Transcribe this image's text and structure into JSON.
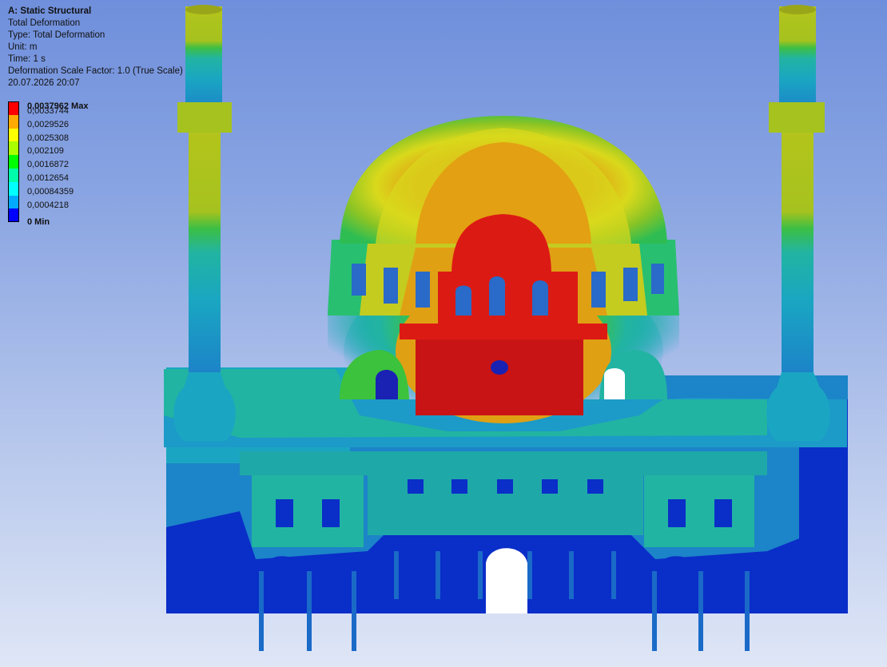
{
  "analysis": {
    "title": "A: Static Structural",
    "result": "Total Deformation",
    "type_line": "Type: Total Deformation",
    "unit_line": "Unit: m",
    "time_line": "Time: 1 s",
    "scale_line": "Deformation Scale Factor: 1.0 (True Scale)",
    "date_line": "20.07.2026 20:07"
  },
  "legend": {
    "max_label": "0,0037962 Max",
    "min_label": "0 Min",
    "levels": [
      {
        "label": "0,0033744",
        "color": "#ff0000"
      },
      {
        "label": "0,0029526",
        "color": "#ffaa00"
      },
      {
        "label": "0,0025308",
        "color": "#ffff00"
      },
      {
        "label": "0,002109",
        "color": "#aaff00"
      },
      {
        "label": "0,0016872",
        "color": "#00ff00"
      },
      {
        "label": "0,0012654",
        "color": "#00ffaa"
      },
      {
        "label": "0,00084359",
        "color": "#00ffff"
      },
      {
        "label": "0,0004218",
        "color": "#00aaff"
      },
      {
        "label": "",
        "color": "#0000ff"
      }
    ]
  },
  "contour_colors": {
    "red": "#dc1a14",
    "orange": "#e3a012",
    "yellow": "#d8d81a",
    "yellow_green": "#a4c41c",
    "green": "#3cc23c",
    "teal": "#22b4a2",
    "cyan": "#1aa6c2",
    "light_blue": "#1c84c8",
    "blue": "#0a2ec8"
  }
}
